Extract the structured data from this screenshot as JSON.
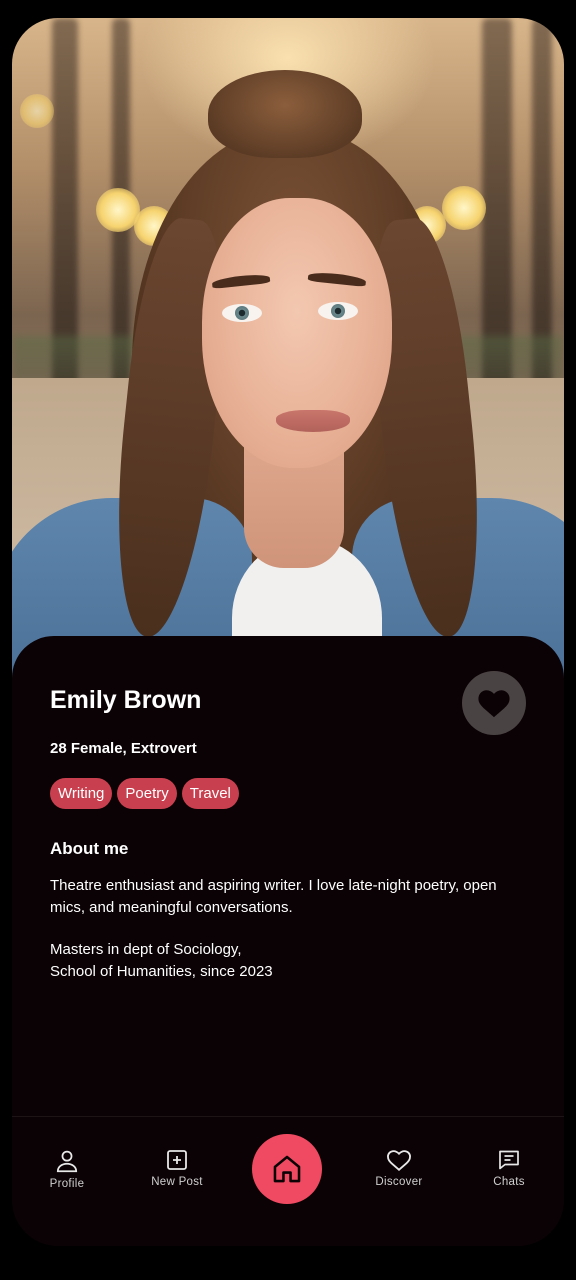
{
  "profile": {
    "name": "Emily Brown",
    "meta": "28 Female, Extrovert",
    "tags": [
      "Writing",
      "Poetry",
      "Travel"
    ],
    "about_title": "About me",
    "bio": "Theatre enthusiast and aspiring writer. I love late-night poetry, open mics, and meaningful conversations.",
    "education_line1": "Masters in dept of Sociology,",
    "education_line2": "School of Humanities, since 2023"
  },
  "icons": {
    "like": "heart-icon",
    "profile": "person-icon",
    "new_post": "plus-square-icon",
    "home": "home-icon",
    "discover": "heart-outline-icon",
    "chats": "chat-icon"
  },
  "nav": {
    "profile": "Profile",
    "new_post": "New Post",
    "discover": "Discover",
    "chats": "Chats"
  },
  "colors": {
    "background": "#0b0205",
    "tag": "#c8404f",
    "accent": "#f04a63",
    "like_button": "#4a4343"
  }
}
